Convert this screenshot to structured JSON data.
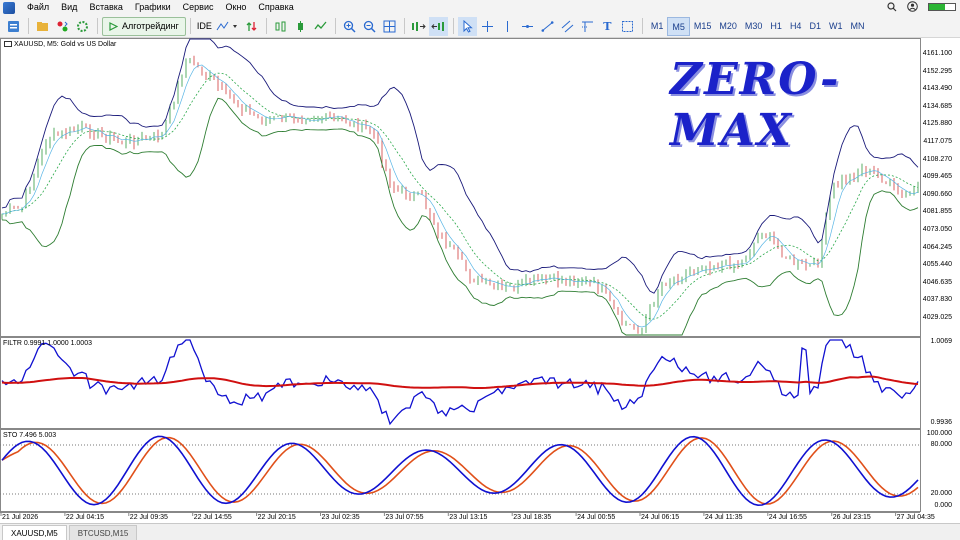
{
  "menu": {
    "items": [
      "Файл",
      "Вид",
      "Вставка",
      "Графики",
      "Сервис",
      "Окно",
      "Справка"
    ]
  },
  "toolbar": {
    "algo_label": "Алготрейдинг",
    "ide_label": "IDE",
    "timeframes": [
      "M1",
      "M5",
      "M15",
      "M20",
      "M30",
      "H1",
      "H4",
      "D1",
      "W1",
      "MN"
    ],
    "active_timeframe": "M5"
  },
  "chart": {
    "symbol_title": "XAUUSD, M5:  Gold vs US Dollar",
    "watermark": "ZERO-MAX",
    "price_axis": [
      "4161.100",
      "4152.295",
      "4143.490",
      "4134.685",
      "4125.880",
      "4117.075",
      "4108.270",
      "4099.465",
      "4090.660",
      "4081.855",
      "4073.050",
      "4064.245",
      "4055.440",
      "4046.635",
      "4037.830",
      "4029.025"
    ],
    "filter_label": "FILTR 0.9991 1.0000 1.0003",
    "filter_axis": [
      "1.0069",
      "0.9936"
    ],
    "sto_label": "STO 7.496 5.003",
    "sto_axis": [
      "100.000",
      "80.000",
      "20.000",
      "0.000"
    ],
    "time_axis": [
      "21 Jul 2026",
      "22 Jul 04:15",
      "22 Jul 09:35",
      "22 Jul 14:55",
      "22 Jul 20:15",
      "23 Jul 02:35",
      "23 Jul 07:55",
      "23 Jul 13:15",
      "23 Jul 18:35",
      "24 Jul 00:55",
      "24 Jul 06:15",
      "24 Jul 11:35",
      "24 Jul 16:55",
      "26 Jul 23:15",
      "27 Jul 04:35"
    ],
    "colors": {
      "bands": "#1a1a7a",
      "mid_band": "#2e7d32",
      "filter_line": "#1010d0",
      "filter_signal": "#d01010",
      "sto_main": "#1010d0",
      "sto_signal": "#e0501a",
      "watermark": "#1b22c9"
    }
  },
  "tabs": [
    {
      "label": "XAUUSD,M5",
      "active": true
    },
    {
      "label": "BTCUSD,M15",
      "active": false
    }
  ]
}
